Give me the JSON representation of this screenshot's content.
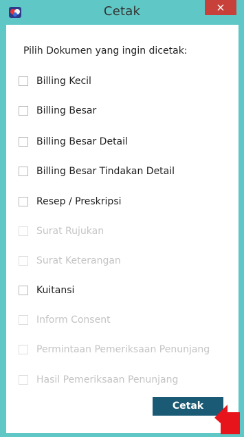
{
  "window": {
    "title": "Cetak",
    "close_label": "×",
    "app_icon": "app-logo-icon"
  },
  "dialog": {
    "prompt": "Pilih Dokumen yang ingin dicetak:",
    "options": [
      {
        "label": "Billing Kecil",
        "enabled": true,
        "checked": false
      },
      {
        "label": "Billing Besar",
        "enabled": true,
        "checked": false
      },
      {
        "label": "Billing Besar Detail",
        "enabled": true,
        "checked": false
      },
      {
        "label": "Billing Besar Tindakan Detail",
        "enabled": true,
        "checked": false
      },
      {
        "label": "Resep / Preskripsi",
        "enabled": true,
        "checked": false
      },
      {
        "label": "Surat Rujukan",
        "enabled": false,
        "checked": false
      },
      {
        "label": "Surat Keterangan",
        "enabled": false,
        "checked": false
      },
      {
        "label": "Kuitansi",
        "enabled": true,
        "checked": false
      },
      {
        "label": "Inform Consent",
        "enabled": false,
        "checked": false
      },
      {
        "label": "Permintaan Pemeriksaan Penunjang",
        "enabled": false,
        "checked": false
      },
      {
        "label": "Hasil Pemeriksaan Penunjang",
        "enabled": false,
        "checked": false
      }
    ],
    "print_button": "Cetak"
  },
  "colors": {
    "titlebar": "#5fc8c6",
    "close": "#c7403a",
    "button": "#1a5a74",
    "cursor": "#e8141b"
  }
}
